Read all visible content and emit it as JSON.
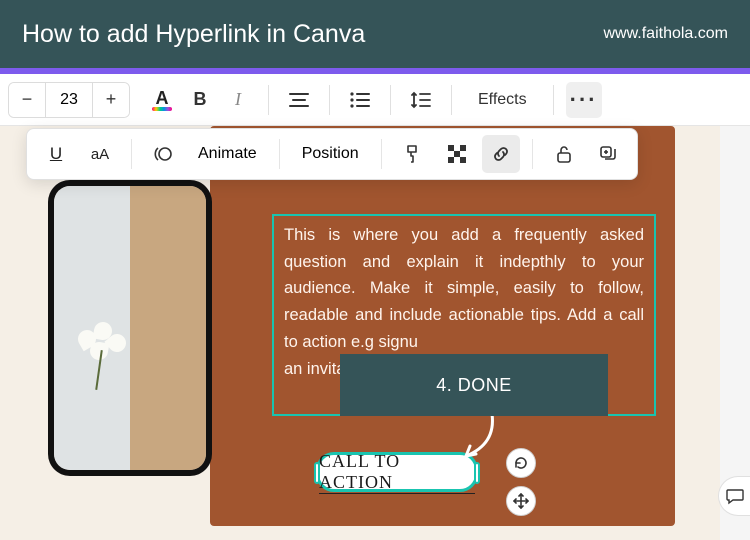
{
  "header": {
    "title": "How to add Hyperlink in Canva",
    "url": "www.faithola.com"
  },
  "toolbar1": {
    "font_size": "23",
    "effects": "Effects"
  },
  "toolbar2": {
    "animate": "Animate",
    "position": "Position"
  },
  "canvas": {
    "paragraph": "This is where you add a frequently asked question and explain it indepthly to your audience. Make it simple, easily to follow, readable and include actionable tips. Add a call to action e.g signu",
    "paragraph_line2": "an invita",
    "callout": "4. DONE",
    "cta": "CALL TO ACTION"
  }
}
